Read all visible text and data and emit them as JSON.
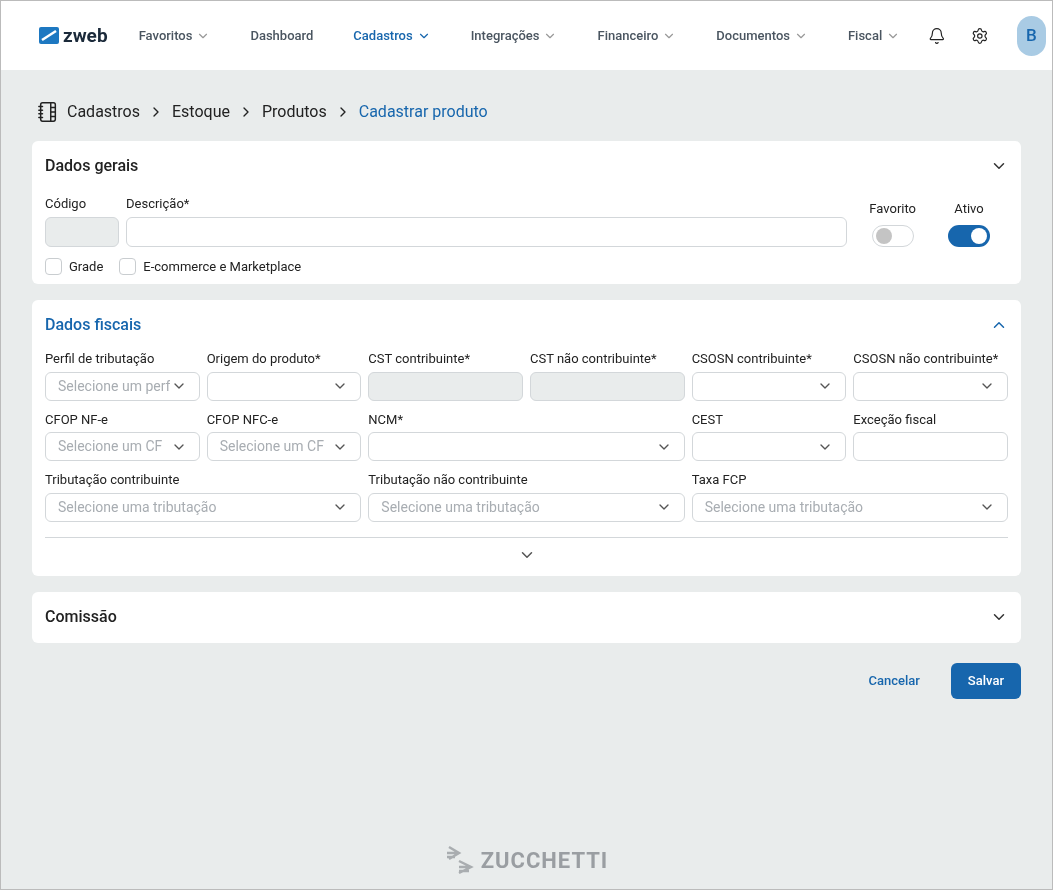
{
  "header": {
    "logo": "zweb",
    "nav": [
      {
        "label": "Favoritos",
        "dropdown": true,
        "selected": false
      },
      {
        "label": "Dashboard",
        "dropdown": false,
        "selected": false
      },
      {
        "label": "Cadastros",
        "dropdown": true,
        "selected": true
      },
      {
        "label": "Integrações",
        "dropdown": true,
        "selected": false
      },
      {
        "label": "Financeiro",
        "dropdown": true,
        "selected": false
      },
      {
        "label": "Documentos",
        "dropdown": true,
        "selected": false
      },
      {
        "label": "Fiscal",
        "dropdown": true,
        "selected": false
      }
    ],
    "avatar": "B"
  },
  "breadcrumb": [
    "Cadastros",
    "Estoque",
    "Produtos",
    "Cadastrar produto"
  ],
  "dados_gerais": {
    "title": "Dados gerais",
    "expanded": false,
    "codigo": {
      "label": "Código",
      "disabled": true
    },
    "descricao": {
      "label": "Descrição*"
    },
    "toggles": [
      {
        "label": "Favorito",
        "on": false
      },
      {
        "label": "Ativo",
        "on": true
      }
    ],
    "checkboxes": [
      {
        "label": "Grade",
        "checked": false
      },
      {
        "label": "E-commerce e Marketplace",
        "checked": false
      }
    ]
  },
  "dados_fiscais": {
    "title": "Dados fiscais",
    "expanded": true,
    "fields": [
      {
        "label": "Perfil de tributação",
        "kind": "select",
        "placeholder": "Selecione um perf",
        "wide": false
      },
      {
        "label": "Origem do produto*",
        "kind": "select",
        "wide": false
      },
      {
        "label": "CST contribuinte*",
        "kind": "disabled",
        "wide": false
      },
      {
        "label": "CST não contribuinte*",
        "kind": "disabled",
        "wide": false
      },
      {
        "label": "CSOSN contribuinte*",
        "kind": "select",
        "wide": false
      },
      {
        "label": "CSOSN não contribuinte*",
        "kind": "select",
        "wide": false
      },
      {
        "label": "CFOP NF-e",
        "kind": "select",
        "placeholder": "Selecione um CF",
        "wide": false
      },
      {
        "label": "CFOP NFC-e",
        "kind": "select",
        "placeholder": "Selecione um CF",
        "wide": false
      },
      {
        "label": "NCM*",
        "kind": "select",
        "wide": true
      },
      {
        "label": "CEST",
        "kind": "select",
        "wide": false
      },
      {
        "label": "Exceção fiscal",
        "kind": "input",
        "wide": false
      },
      {
        "label": "Tributação contribuinte",
        "kind": "select",
        "placeholder": "Selecione uma tributação",
        "wide": true
      },
      {
        "label": "Tributação não contribuinte",
        "kind": "select",
        "placeholder": "Selecione uma tributação",
        "wide": true
      },
      {
        "label": "Taxa FCP",
        "kind": "select",
        "placeholder": "Selecione uma tributação",
        "wide": true
      }
    ]
  },
  "comissao": {
    "title": "Comissão",
    "expanded": false
  },
  "buttons": [
    {
      "label": "Cancelar",
      "kind": "link"
    },
    {
      "label": "Salvar",
      "kind": "primary"
    }
  ],
  "footer": "ZUCCHETTI"
}
